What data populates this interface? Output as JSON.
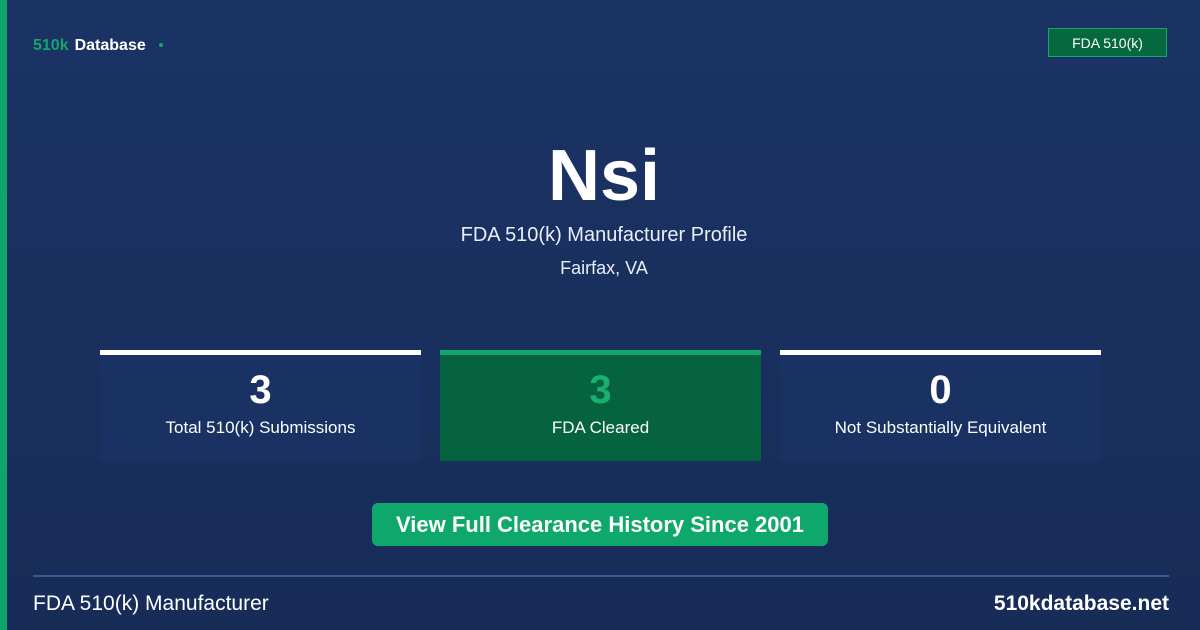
{
  "header": {
    "brand_accent": "510k",
    "brand_rest": "Database",
    "badge": "FDA 510(k)"
  },
  "profile": {
    "name": "Nsi",
    "subtitle": "FDA 510(k) Manufacturer Profile",
    "location": "Fairfax, VA"
  },
  "stats": [
    {
      "value": "3",
      "label": "Total 510(k) Submissions"
    },
    {
      "value": "3",
      "label": "FDA Cleared"
    },
    {
      "value": "0",
      "label": "Not Substantially Equivalent"
    }
  ],
  "cta": {
    "label": "View Full Clearance History Since 2001"
  },
  "footer": {
    "left": "FDA 510(k) Manufacturer",
    "right": "510kdatabase.net"
  },
  "colors": {
    "background": "#1b3365",
    "accent_green": "#13a66a",
    "cleared_card": "#05633f",
    "card": "#193163"
  }
}
